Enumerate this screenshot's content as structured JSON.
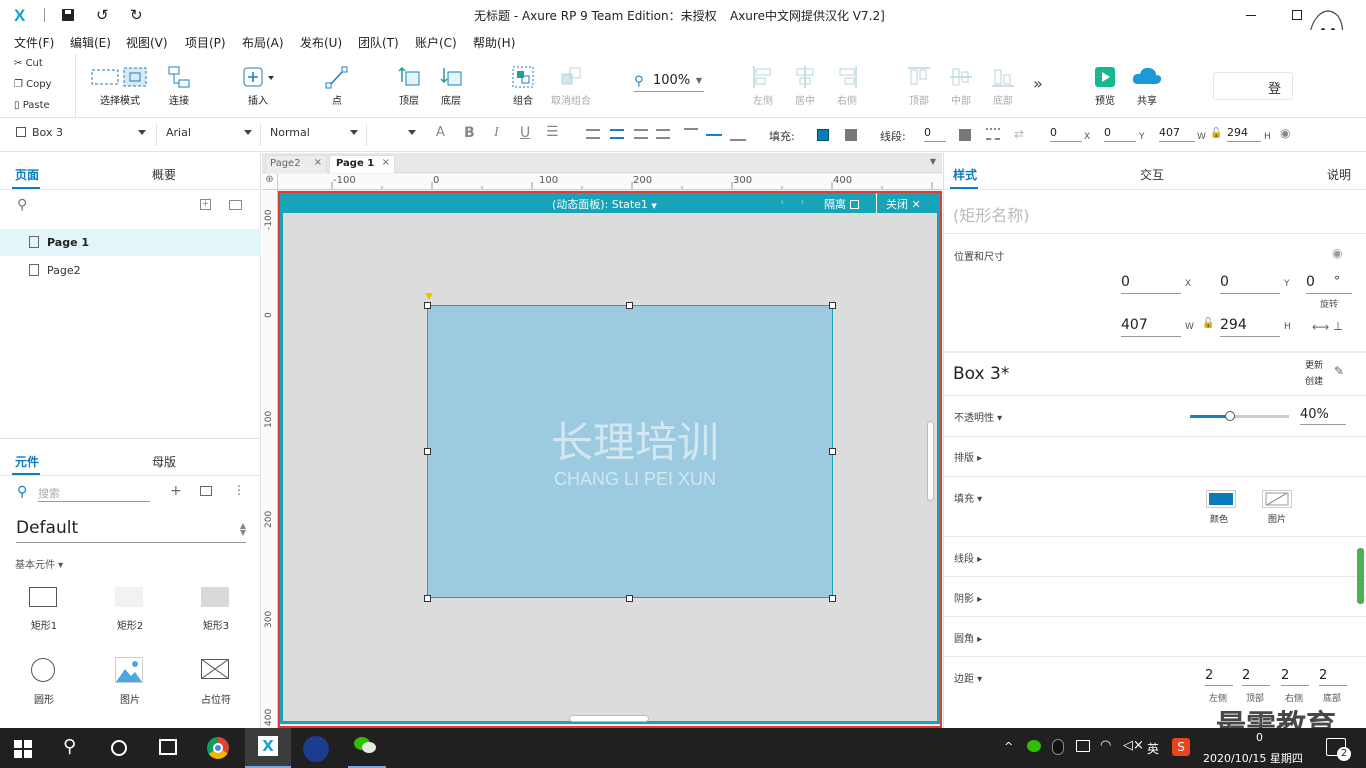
{
  "window": {
    "title": "无标题 - Axure RP 9 Team Edition：未授权",
    "title_suffix": "Axure中文网提供汉化 V7.2]"
  },
  "menu": [
    "文件(F)",
    "编辑(E)",
    "视图(V)",
    "项目(P)",
    "布局(A)",
    "发布(U)",
    "团队(T)",
    "账户(C)",
    "帮助(H)"
  ],
  "clipboard": {
    "cut": "Cut",
    "copy": "Copy",
    "paste": "Paste"
  },
  "toolbar": {
    "select_mode": "选择模式",
    "connect": "连接",
    "insert": "插入",
    "point": "点",
    "top_layer": "顶层",
    "bottom_layer": "底层",
    "group": "组合",
    "ungroup": "取消组合",
    "zoom": "100%",
    "align_left": "左侧",
    "align_center": "居中",
    "align_right": "右侧",
    "align_top": "顶部",
    "align_middle": "中部",
    "align_bottom": "底部",
    "preview": "预览",
    "share": "共享",
    "login": "登"
  },
  "format": {
    "widget_name": "Box 3",
    "font": "Arial",
    "weight": "Normal",
    "fill_label": "填充:",
    "stroke_label": "线段:",
    "stroke_value": "0",
    "x": "0",
    "y": "0",
    "w": "407",
    "h": "294",
    "x_lbl": "X",
    "y_lbl": "Y",
    "w_lbl": "W",
    "h_lbl": "H"
  },
  "left": {
    "tab_pages": "页面",
    "tab_outline": "概要",
    "pages": [
      "Page 1",
      "Page2"
    ],
    "tab_widgets": "元件",
    "tab_masters": "母版",
    "search_placeholder": "搜索",
    "library": "Default",
    "category": "基本元件",
    "widgets": [
      "矩形1",
      "矩形2",
      "矩形3",
      "圆形",
      "图片",
      "占位符"
    ]
  },
  "tabs": [
    "Page2",
    "Page 1"
  ],
  "ruler": {
    "h": [
      "-100",
      "0",
      "100",
      "200",
      "300",
      "400"
    ],
    "v": [
      "-100",
      "0",
      "100",
      "200",
      "300",
      "400"
    ]
  },
  "dynamic_panel": {
    "state": "(动态面板): State1",
    "isolate": "隔离",
    "close": "关闭"
  },
  "watermark": {
    "cn": "长理培训",
    "en": "CHANG LI PEI XUN"
  },
  "right": {
    "tab_style": "样式",
    "tab_interact": "交互",
    "tab_notes": "说明",
    "shape_name_placeholder": "(矩形名称)",
    "pos_size": "位置和尺寸",
    "x": "0",
    "y": "0",
    "rotation": "0",
    "w": "407",
    "h": "294",
    "x_lbl": "X",
    "y_lbl": "Y",
    "rot_lbl": "旋转",
    "deg": "°",
    "w_lbl": "W",
    "h_lbl": "H",
    "style_name": "Box 3*",
    "update": "更新",
    "create": "创建",
    "opacity_label": "不透明性",
    "opacity_value": "40%",
    "layout": "排版",
    "fill": "填充",
    "fill_color": "颜色",
    "fill_image": "图片",
    "stroke": "线段",
    "shadow": "阴影",
    "corner": "圆角",
    "padding": "边距",
    "padding_values": [
      "2",
      "2",
      "2",
      "2"
    ],
    "padding_labels": [
      "左侧",
      "顶部",
      "右侧",
      "底部"
    ]
  },
  "taskbar": {
    "ime": "英",
    "date": "2020/10/15 星期四",
    "time": "0",
    "notif": "2",
    "brand": "最需教育"
  },
  "colors": {
    "accent": "#0a7bbd",
    "panel_header": "#17a4b8",
    "box_fill": "#9ccae0",
    "selection": "#e53935"
  }
}
